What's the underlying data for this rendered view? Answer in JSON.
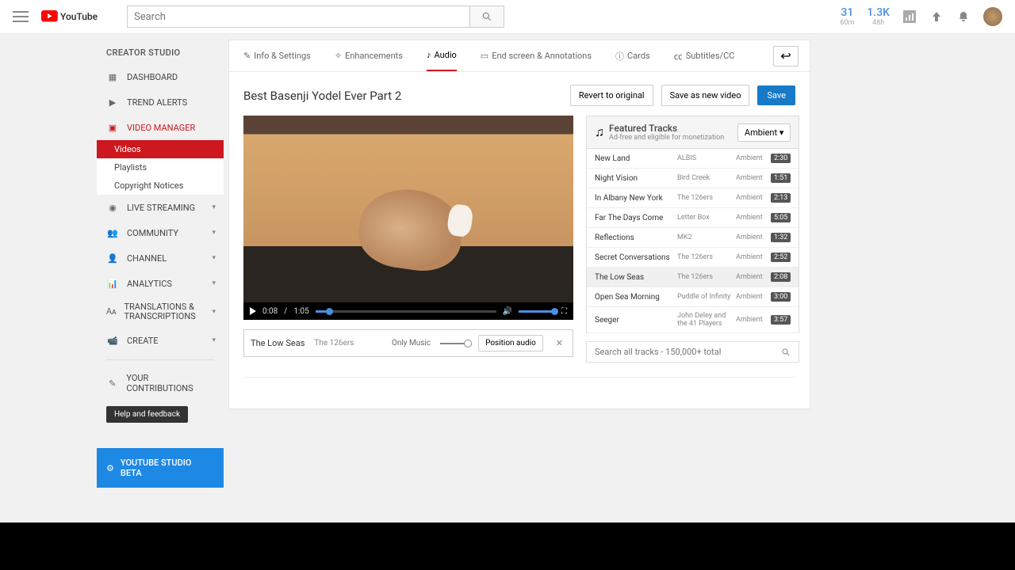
{
  "header": {
    "search_placeholder": "Search",
    "stats": [
      {
        "big": "31",
        "small": "60m"
      },
      {
        "big": "1.3K",
        "small": "48h"
      }
    ]
  },
  "sidebar": {
    "heading": "CREATOR STUDIO",
    "items": [
      {
        "label": "DASHBOARD",
        "chev": false
      },
      {
        "label": "TREND ALERTS",
        "chev": false
      },
      {
        "label": "VIDEO MANAGER",
        "chev": false,
        "active": true
      },
      {
        "label": "LIVE STREAMING",
        "chev": true
      },
      {
        "label": "COMMUNITY",
        "chev": true
      },
      {
        "label": "CHANNEL",
        "chev": true
      },
      {
        "label": "ANALYTICS",
        "chev": true
      },
      {
        "label": "TRANSLATIONS & TRANSCRIPTIONS",
        "chev": true
      },
      {
        "label": "CREATE",
        "chev": true
      }
    ],
    "subitems": [
      {
        "label": "Videos",
        "active": true
      },
      {
        "label": "Playlists",
        "active": false
      },
      {
        "label": "Copyright Notices",
        "active": false
      }
    ],
    "contributions": "YOUR CONTRIBUTIONS",
    "help": "Help and feedback",
    "beta": "YOUTUBE STUDIO BETA"
  },
  "tabs": [
    {
      "label": "Info & Settings"
    },
    {
      "label": "Enhancements"
    },
    {
      "label": "Audio",
      "active": true
    },
    {
      "label": "End screen & Annotations"
    },
    {
      "label": "Cards"
    },
    {
      "label": "Subtitles/CC"
    }
  ],
  "video": {
    "title": "Best Basenji Yodel Ever Part 2",
    "revert": "Revert to original",
    "save_new": "Save as new video",
    "save": "Save",
    "time_current": "0:08",
    "time_sep": "/",
    "time_total": "1:05"
  },
  "selected_track": {
    "name": "The Low Seas",
    "artist": "The 126ers",
    "mix_label": "Only Music",
    "position_btn": "Position audio"
  },
  "featured": {
    "title": "Featured Tracks",
    "subtitle": "Ad-free and eligible for monetization",
    "genre": "Ambient",
    "search_placeholder": "Search all tracks - 150,000+ total"
  },
  "tracks": [
    {
      "title": "New Land",
      "artist": "ALBIS",
      "genre": "Ambient",
      "dur": "2:30"
    },
    {
      "title": "Night Vision",
      "artist": "Bird Creek",
      "genre": "Ambient",
      "dur": "1:51"
    },
    {
      "title": "In Albany New York",
      "artist": "The 126ers",
      "genre": "Ambient",
      "dur": "2:13"
    },
    {
      "title": "Far The Days Come",
      "artist": "Letter Box",
      "genre": "Ambient",
      "dur": "5:05"
    },
    {
      "title": "Reflections",
      "artist": "MK2",
      "genre": "Ambient",
      "dur": "1:32"
    },
    {
      "title": "Secret Conversations",
      "artist": "The 126ers",
      "genre": "Ambient",
      "dur": "2:52"
    },
    {
      "title": "The Low Seas",
      "artist": "The 126ers",
      "genre": "Ambient",
      "dur": "2:08",
      "sel": true
    },
    {
      "title": "Open Sea Morning",
      "artist": "Puddle of Infinity",
      "genre": "Ambient",
      "dur": "3:00"
    },
    {
      "title": "Seeger",
      "artist": "John Deley and the 41 Players",
      "genre": "Ambient",
      "dur": "3:57"
    }
  ]
}
